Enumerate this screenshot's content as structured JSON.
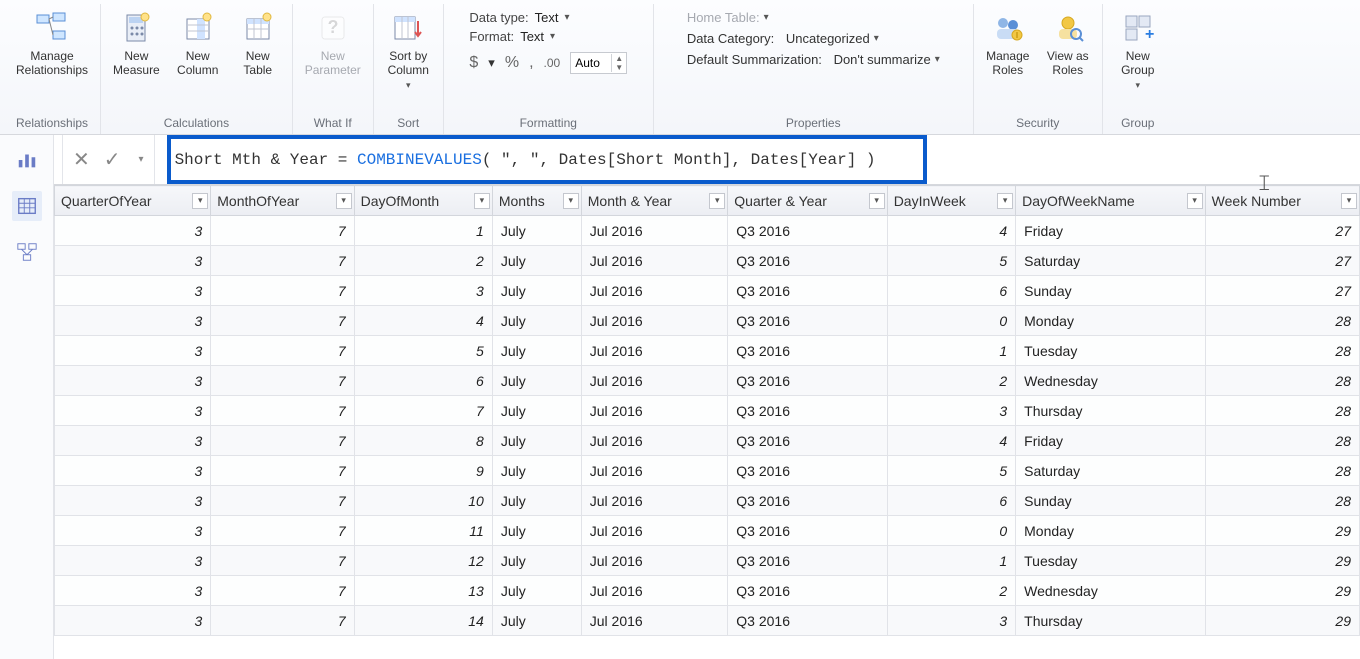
{
  "ribbon": {
    "relationships": {
      "manage": "Manage\nRelationships",
      "group": "Relationships"
    },
    "calculations": {
      "measure": "New\nMeasure",
      "column": "New\nColumn",
      "table": "New\nTable",
      "group": "Calculations"
    },
    "whatif": {
      "parameter": "New\nParameter",
      "group": "What If"
    },
    "sort": {
      "sortby": "Sort by\nColumn",
      "group": "Sort"
    },
    "formatting": {
      "datatype_label": "Data type:",
      "datatype_value": "Text",
      "format_label": "Format:",
      "format_value": "Text",
      "currency": "$",
      "percent": "%",
      "comma": ",",
      "dec_icon": ".00",
      "auto": "Auto",
      "group": "Formatting"
    },
    "properties": {
      "home_table_label": "Home Table:",
      "category_label": "Data Category:",
      "category_value": "Uncategorized",
      "summarization_label": "Default Summarization:",
      "summarization_value": "Don't summarize",
      "group": "Properties"
    },
    "security": {
      "manage_roles": "Manage\nRoles",
      "view_as": "View as\nRoles",
      "group": "Security"
    },
    "groups": {
      "new_group": "New\nGroup",
      "group": "Group"
    }
  },
  "formula": {
    "pre": "Short Mth & Year = ",
    "fn": "COMBINEVALUES",
    "args": "( \", \", Dates[Short Month], Dates[Year] )"
  },
  "columns": [
    "QuarterOfYear",
    "MonthOfYear",
    "DayOfMonth",
    "Months",
    "Month & Year",
    "Quarter & Year",
    "DayInWeek",
    "DayOfWeekName",
    "Week Number"
  ],
  "column_align": [
    "num",
    "num",
    "num",
    "txt",
    "txt",
    "txt",
    "num",
    "txt",
    "num"
  ],
  "rows": [
    [
      3,
      7,
      1,
      "July",
      "Jul 2016",
      "Q3 2016",
      4,
      "Friday",
      27
    ],
    [
      3,
      7,
      2,
      "July",
      "Jul 2016",
      "Q3 2016",
      5,
      "Saturday",
      27
    ],
    [
      3,
      7,
      3,
      "July",
      "Jul 2016",
      "Q3 2016",
      6,
      "Sunday",
      27
    ],
    [
      3,
      7,
      4,
      "July",
      "Jul 2016",
      "Q3 2016",
      0,
      "Monday",
      28
    ],
    [
      3,
      7,
      5,
      "July",
      "Jul 2016",
      "Q3 2016",
      1,
      "Tuesday",
      28
    ],
    [
      3,
      7,
      6,
      "July",
      "Jul 2016",
      "Q3 2016",
      2,
      "Wednesday",
      28
    ],
    [
      3,
      7,
      7,
      "July",
      "Jul 2016",
      "Q3 2016",
      3,
      "Thursday",
      28
    ],
    [
      3,
      7,
      8,
      "July",
      "Jul 2016",
      "Q3 2016",
      4,
      "Friday",
      28
    ],
    [
      3,
      7,
      9,
      "July",
      "Jul 2016",
      "Q3 2016",
      5,
      "Saturday",
      28
    ],
    [
      3,
      7,
      10,
      "July",
      "Jul 2016",
      "Q3 2016",
      6,
      "Sunday",
      28
    ],
    [
      3,
      7,
      11,
      "July",
      "Jul 2016",
      "Q3 2016",
      0,
      "Monday",
      29
    ],
    [
      3,
      7,
      12,
      "July",
      "Jul 2016",
      "Q3 2016",
      1,
      "Tuesday",
      29
    ],
    [
      3,
      7,
      13,
      "July",
      "Jul 2016",
      "Q3 2016",
      2,
      "Wednesday",
      29
    ],
    [
      3,
      7,
      14,
      "July",
      "Jul 2016",
      "Q3 2016",
      3,
      "Thursday",
      29
    ]
  ]
}
